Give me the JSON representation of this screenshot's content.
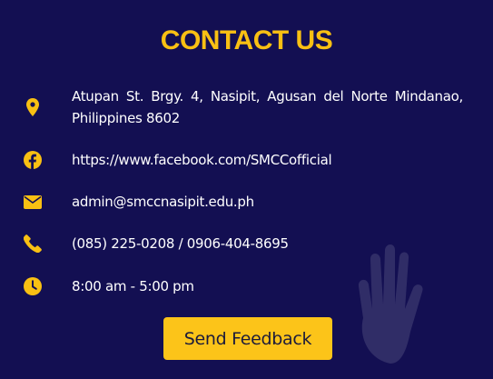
{
  "title": "CONTACT US",
  "accent_color": "#f9c013",
  "background_color": "#130f52",
  "contacts": [
    {
      "icon": "map-pin-icon",
      "text": "Atupan St. Brgy. 4, Nasipit, Agusan del Norte Mindanao, Philippines 8602"
    },
    {
      "icon": "facebook-icon",
      "text": "https://www.facebook.com/SMCCofficial"
    },
    {
      "icon": "envelope-icon",
      "text": "admin@smccnasipit.edu.ph"
    },
    {
      "icon": "phone-icon",
      "text": "(085) 225-0208 / 0906-404-8695"
    },
    {
      "icon": "clock-icon",
      "text": "8:00 am - 5:00 pm"
    }
  ],
  "button": {
    "label": "Send Feedback"
  }
}
